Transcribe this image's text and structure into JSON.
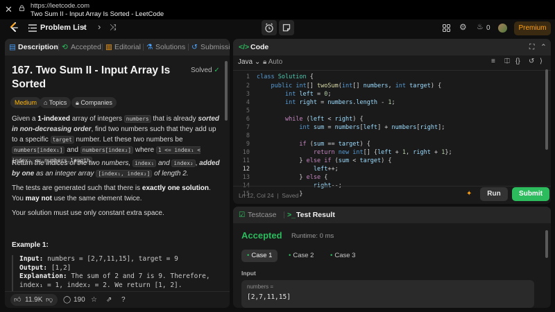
{
  "browser": {
    "url": "https://leetcode.com",
    "page_title": "Two Sum II - Input Array Is Sorted - LeetCode"
  },
  "nav": {
    "problem_list": "Problem List",
    "streak_count": "0",
    "premium": "Premium"
  },
  "left_tabs": {
    "description": "Description",
    "accepted": "Accepted",
    "editorial": "Editorial",
    "solutions": "Solutions",
    "submissions": "Submissio"
  },
  "problem": {
    "title": "167. Two Sum II - Input Array Is Sorted",
    "status": "Solved",
    "difficulty": "Medium",
    "topics": "Topics",
    "companies": "Companies",
    "example_title": "Example 1:",
    "example_input_label": "Input:",
    "example_input": "numbers = [2,7,11,15], target = 9",
    "example_output_label": "Output:",
    "example_output": "[1,2]",
    "example_expl_label": "Explanation:",
    "example_expl_1": "The sum of 2 and 7 is 9. Therefore,",
    "example_expl_2": "index₁ = 1, index₂ = 2. We return [1, 2]."
  },
  "bottom": {
    "likes": "11.9K",
    "comments": "190"
  },
  "code_panel": {
    "tab": "Code",
    "language": "Java",
    "mode": "Auto",
    "status": "Ln 12, Col 24",
    "saved": "Saved",
    "run": "Run",
    "submit": "Submit"
  },
  "test_panel": {
    "tab_testcase": "Testcase",
    "tab_result": "Test Result",
    "verdict": "Accepted",
    "runtime": "Runtime: 0 ms",
    "cases": [
      "Case 1",
      "Case 2",
      "Case 3"
    ],
    "input_label": "Input",
    "var_name": "numbers =",
    "var_value": "[2,7,11,15]"
  },
  "colors": {
    "accent_green": "#2cbb5d",
    "medium": "#ffb800",
    "premium": "#ffa116"
  }
}
